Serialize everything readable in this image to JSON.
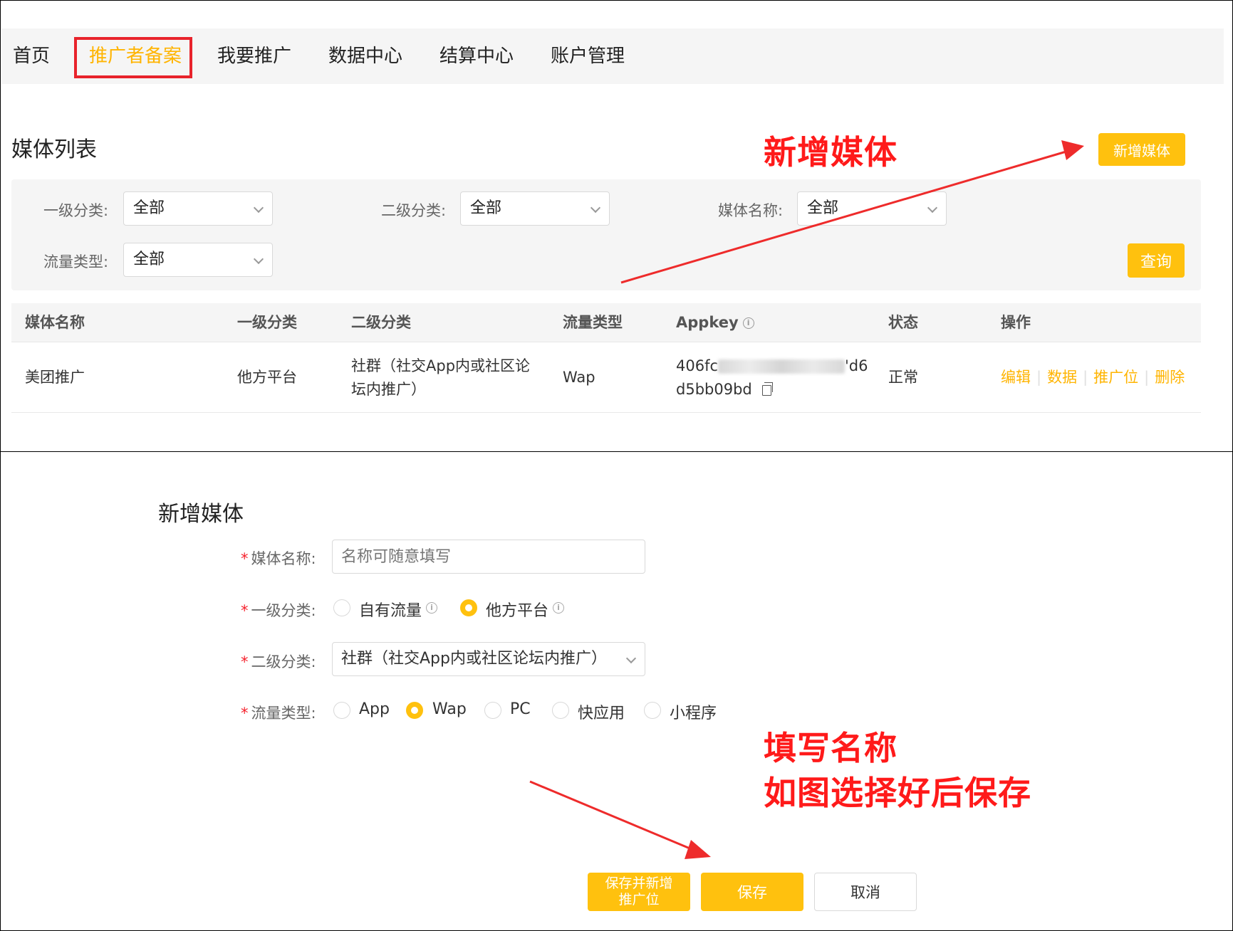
{
  "nav": {
    "items": [
      {
        "label": "首页"
      },
      {
        "label": "推广者备案",
        "active": true
      },
      {
        "label": "我要推广"
      },
      {
        "label": "数据中心"
      },
      {
        "label": "结算中心"
      },
      {
        "label": "账户管理"
      }
    ]
  },
  "media_list": {
    "title": "媒体列表",
    "add_button": "新增媒体",
    "query_button": "查询",
    "filters": {
      "level1": {
        "label": "一级分类:",
        "value": "全部"
      },
      "level2": {
        "label": "二级分类:",
        "value": "全部"
      },
      "media_name": {
        "label": "媒体名称:",
        "value": "全部"
      },
      "traffic_type": {
        "label": "流量类型:",
        "value": "全部"
      }
    },
    "columns": [
      "媒体名称",
      "一级分类",
      "二级分类",
      "流量类型",
      "Appkey",
      "状态",
      "操作"
    ],
    "rows": [
      {
        "media_name": "美团推广",
        "level1": "他方平台",
        "level2_line1": "社群（社交App内或社区论",
        "level2_line2": "坛内推广）",
        "traffic_type": "Wap",
        "appkey_start": "406fc",
        "appkey_end": "'d6",
        "appkey_line2": "d5bb09bd",
        "status": "正常",
        "ops": [
          "编辑",
          "数据",
          "推广位",
          "删除"
        ]
      }
    ]
  },
  "annotations": {
    "top": "新增媒体",
    "bottom_line1": "填写名称",
    "bottom_line2": "如图选择好后保存",
    "color": "#ff1a1a"
  },
  "form": {
    "title": "新增媒体",
    "media_name": {
      "label": "媒体名称:",
      "placeholder": "名称可随意填写"
    },
    "level1": {
      "label": "一级分类:",
      "options": [
        "自有流量",
        "他方平台"
      ],
      "selected": "他方平台"
    },
    "level2": {
      "label": "二级分类:",
      "value": "社群（社交App内或社区论坛内推广）"
    },
    "traffic_type": {
      "label": "流量类型:",
      "options": [
        "App",
        "Wap",
        "PC",
        "快应用",
        "小程序"
      ],
      "selected": "Wap"
    },
    "buttons": {
      "save_and_add_line1": "保存并新增",
      "save_and_add_line2": "推广位",
      "save": "保存",
      "cancel": "取消"
    }
  },
  "colors": {
    "accent": "#ffc10e",
    "link": "#ffb400",
    "highlight_box": "#e8232b"
  }
}
